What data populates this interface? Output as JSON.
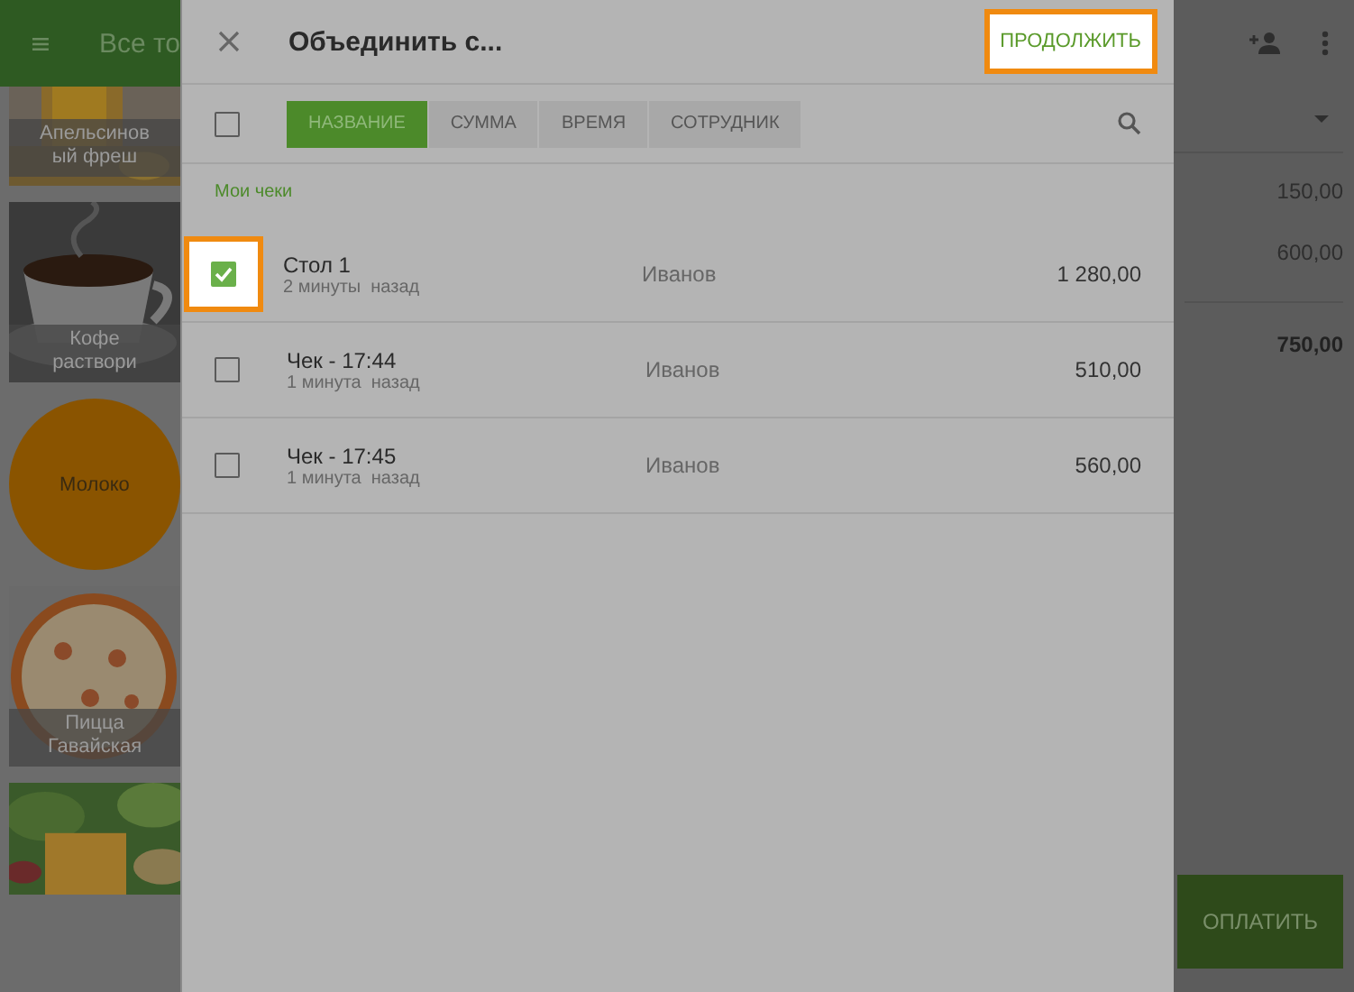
{
  "background_app": {
    "title": "Все то",
    "tiles": [
      {
        "kind": "juice",
        "lines": [
          "Апельсинов",
          "ый фреш"
        ]
      },
      {
        "kind": "coffee",
        "lines": [
          "Кофе",
          "раствори"
        ]
      },
      {
        "kind": "circle",
        "lines": [
          "Молоко"
        ]
      },
      {
        "kind": "pizza",
        "lines": [
          "Пицца",
          "Гавайская"
        ]
      },
      {
        "kind": "salad"
      }
    ],
    "amounts": [
      "150,00",
      "600,00"
    ],
    "total": "750,00",
    "pay_button": "ОПЛАТИТЬ"
  },
  "dialog": {
    "title": "Объединить с...",
    "continue_button": {
      "label": "ПРОДОЛЖИТЬ",
      "highlighted": true
    },
    "select_all": {
      "checked": false
    },
    "sort_tabs": [
      {
        "label": "НАЗВАНИЕ",
        "selected": true
      },
      {
        "label": "СУММА",
        "selected": false
      },
      {
        "label": "ВРЕМЯ",
        "selected": false
      },
      {
        "label": "СОТРУДНИК",
        "selected": false
      }
    ],
    "section": "Мои чеки",
    "rows": [
      {
        "name": "Стол 1",
        "time": "2 минуты  назад",
        "employee": "Иванов",
        "amount": "1 280,00",
        "checked": true,
        "highlighted": true
      },
      {
        "name": "Чек - 17:44",
        "time": "1 минута  назад",
        "employee": "Иванов",
        "amount": "510,00",
        "checked": false,
        "highlighted": false
      },
      {
        "name": "Чек - 17:45",
        "time": "1 минута  назад",
        "employee": "Иванов",
        "amount": "560,00",
        "checked": false,
        "highlighted": false
      }
    ]
  }
}
